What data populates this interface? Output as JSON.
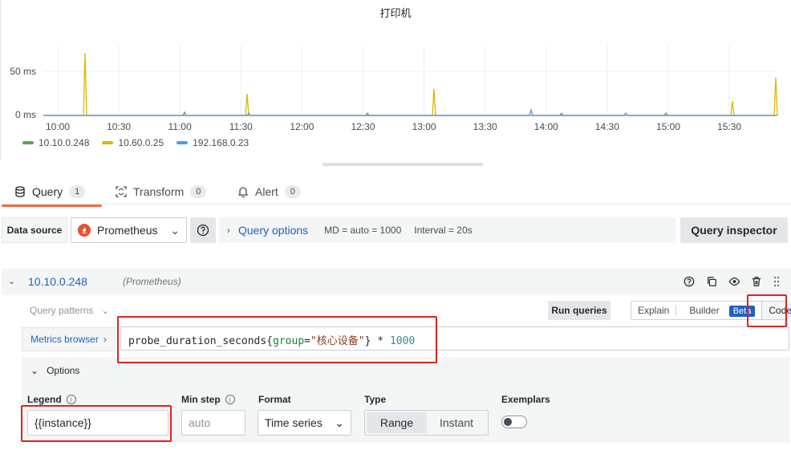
{
  "chart": {
    "title": "打印机",
    "y_ticks": [
      "50 ms",
      "0 ms"
    ],
    "x_ticks": [
      "10:00",
      "10:30",
      "11:00",
      "11:30",
      "12:00",
      "12:30",
      "13:00",
      "13:30",
      "14:00",
      "14:30",
      "15:00",
      "15:30"
    ],
    "legend": [
      {
        "name": "10.10.0.248",
        "color": "#56a64b"
      },
      {
        "name": "10.60.0.25",
        "color": "#e0b400"
      },
      {
        "name": "192.168.0.23",
        "color": "#5794f2"
      }
    ]
  },
  "tabs": [
    {
      "label": "Query",
      "count": "1"
    },
    {
      "label": "Transform",
      "count": "0"
    },
    {
      "label": "Alert",
      "count": "0"
    }
  ],
  "datasource": {
    "label": "Data source",
    "name": "Prometheus"
  },
  "query_options": {
    "title": "Query options",
    "md": "MD = auto = 1000",
    "interval": "Interval = 20s"
  },
  "query_inspector": "Query inspector",
  "query": {
    "ref_name": "10.10.0.248",
    "ds_name": "(Prometheus)",
    "patterns_label": "Query patterns",
    "run_label": "Run queries",
    "mode_explain": "Explain",
    "mode_builder": "Builder",
    "mode_beta": "Beta",
    "mode_code": "Code",
    "metrics_browser": "Metrics browser",
    "expr_metric": "probe_duration_seconds{",
    "expr_label_key": "group",
    "expr_eq": "=",
    "expr_label_val": "\"核心设备\"",
    "expr_close": "} * ",
    "expr_num": "1000"
  },
  "options": {
    "title": "Options",
    "legend_label": "Legend",
    "legend_value": "{{instance}}",
    "minstep_label": "Min step",
    "minstep_placeholder": "auto",
    "format_label": "Format",
    "format_value": "Time series",
    "type_label": "Type",
    "type_range": "Range",
    "type_instant": "Instant",
    "exemplars_label": "Exemplars"
  },
  "colors": {
    "accent": "#1f60c4",
    "tab_active": "#f56a3c",
    "annotation": "#e0221b"
  }
}
